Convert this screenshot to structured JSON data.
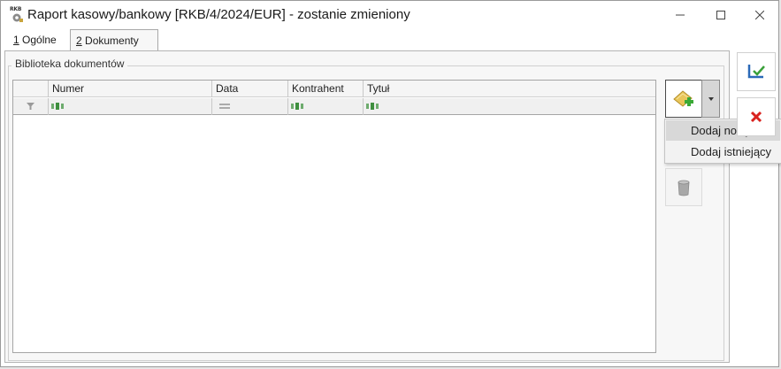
{
  "window": {
    "title": "Raport kasowy/bankowy [RKB/4/2024/EUR] - zostanie zmieniony",
    "icon_label": "RKB",
    "controls": [
      "minimize-icon",
      "maximize-icon",
      "close-icon"
    ]
  },
  "tabs": [
    {
      "key": "1",
      "rest": " Ogólne",
      "active": false
    },
    {
      "key": "2",
      "rest": " Dokumenty",
      "active": true
    }
  ],
  "group": {
    "label": "Biblioteka dokumentów"
  },
  "grid": {
    "columns": [
      "",
      "Numer",
      "Data",
      "Kontrahent",
      "Tytuł"
    ],
    "filter_icons": [
      "funnel-icon",
      "text-filter-icon",
      "equals-filter-icon",
      "text-filter-icon",
      "text-filter-icon"
    ],
    "rows": []
  },
  "toolbar": {
    "add_icon": "add-document-icon",
    "dropdown_icon": "dropdown-arrow-icon",
    "trash_icon": "trash-icon",
    "menu": [
      {
        "label": "Dodaj nowy",
        "highlighted": true
      },
      {
        "label": "Dodaj istniejący",
        "highlighted": false
      }
    ]
  },
  "side": {
    "save_icon": "save-icon",
    "cancel_icon": "cancel-icon"
  },
  "colors": {
    "accent_blue": "#2b6ab8",
    "cancel_red": "#d9221e",
    "add_green": "#39a935",
    "doc_yellow": "#e9c65a"
  }
}
